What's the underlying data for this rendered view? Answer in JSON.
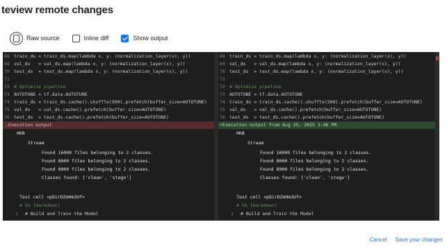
{
  "dialog": {
    "title": "teview remote changes"
  },
  "options": {
    "raw_source": "Raw source",
    "inline_diff": "Inline diff",
    "show_output": "Show output",
    "inline_diff_checked": false,
    "show_output_checked": true
  },
  "left": {
    "l68": "train_ds = train_ds.map(lambda x, y: (normalization_layer(x), y))",
    "l69": "val_ds   = val_ds.map(lambda x, y: (normalization_layer(x), y))",
    "l70": "test_ds  = test_ds.map(lambda x, y: (normalization_layer(x), y))",
    "l71": "",
    "l72": "# Optimize pipeline",
    "l73": "AUTOTUNE = tf.data.AUTOTUNE",
    "l74": "train_ds = train_ds.cache().shuffle(500).prefetch(buffer_size=AUTOTUNE)",
    "l75": "val_ds   = val_ds.cache().prefetch(buffer_size=AUTOTUNE)",
    "l76": "test_ds  = test_ds.cache().prefetch(buffer_size=AUTOTUNE)",
    "exec": "-Execution output",
    "size": "0KB",
    "stream": "Stream",
    "o1": "Found 16000 files belonging to 2 classes.",
    "o2": "Found 8000 files belonging to 2 classes.",
    "o3": "Found 8000 files belonging to 2 classes.",
    "o4": "Classes found: ['clean', 'stego']",
    "textcell": "Text cell <pDirDZmHm3Uf>",
    "md": "# %% [markdown]",
    "l1": "# Build and Train the Model"
  },
  "right": {
    "l68": "train_ds = train_ds.map(lambda x, y: (normalization_layer(x), y))",
    "l69": "val_ds   = val_ds.map(lambda x, y: (normalization_layer(x), y))",
    "l70": "test_ds  = test_ds.map(lambda x, y: (normalization_layer(x), y))",
    "l71": "",
    "l72": "# Optimize pipeline",
    "l73": "AUTOTUNE = tf.data.AUTOTUNE",
    "l74": "train_ds = train_ds.cache().shuffle(500).prefetch(buffer_size=AUTOTUNE)",
    "l75": "val_ds   = val_ds.cache().prefetch(buffer_size=AUTOTUNE)",
    "l76": "test_ds  = test_ds.cache().prefetch(buffer_size=AUTOTUNE)",
    "exec": "+Execution output from Aug 25, 2025 1:46 PM",
    "size": "0KB",
    "stream": "Stream",
    "o1": "Found 16000 files belonging to 2 classes.",
    "o2": "Found 8000 files belonging to 2 classes.",
    "o3": "Found 8000 files belonging to 2 classes.",
    "o4": "Classes found: ['clean', 'stego']",
    "textcell": "Text cell <pDirDZmHm3Uf>",
    "md": "# %% [markdown]",
    "l1": "# Build and Train the Model"
  },
  "line_numbers": {
    "n68": "68",
    "n69": "69",
    "n70": "70",
    "n71": "71",
    "n72": "72",
    "n73": "73",
    "n74": "74",
    "n75": "75",
    "n76": "76",
    "n1": "1"
  },
  "footer": {
    "cancel": "Cancel",
    "save": "Save your changes"
  },
  "colors": {
    "deleted": "#5b2a2a",
    "added": "#2a4a2a",
    "accent": "#1a73e8"
  }
}
